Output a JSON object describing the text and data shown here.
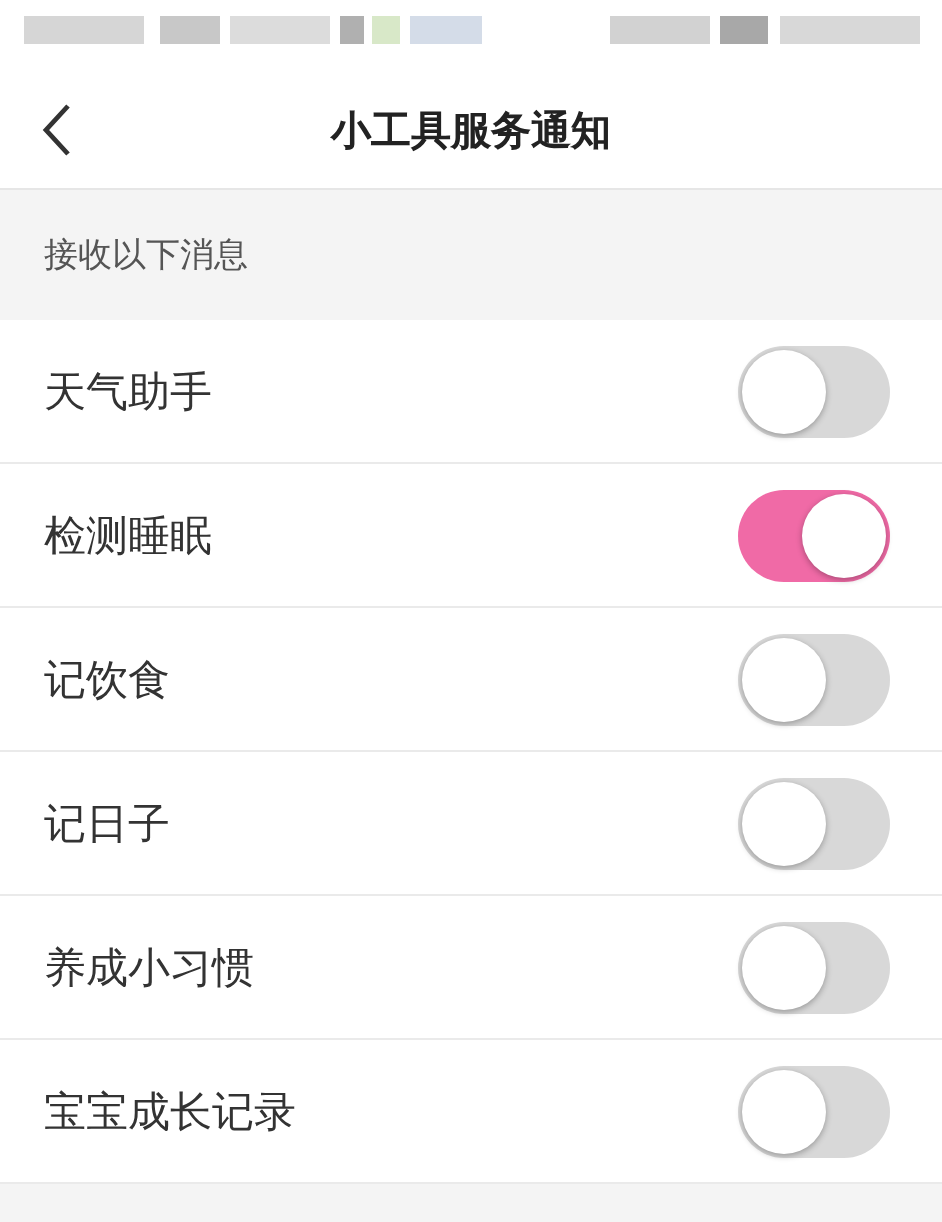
{
  "header": {
    "title": "小工具服务通知"
  },
  "section": {
    "label": "接收以下消息"
  },
  "items": [
    {
      "label": "天气助手",
      "on": false
    },
    {
      "label": "检测睡眠",
      "on": true
    },
    {
      "label": "记饮食",
      "on": false
    },
    {
      "label": "记日子",
      "on": false
    },
    {
      "label": "养成小习惯",
      "on": false
    },
    {
      "label": "宝宝成长记录",
      "on": false
    }
  ]
}
